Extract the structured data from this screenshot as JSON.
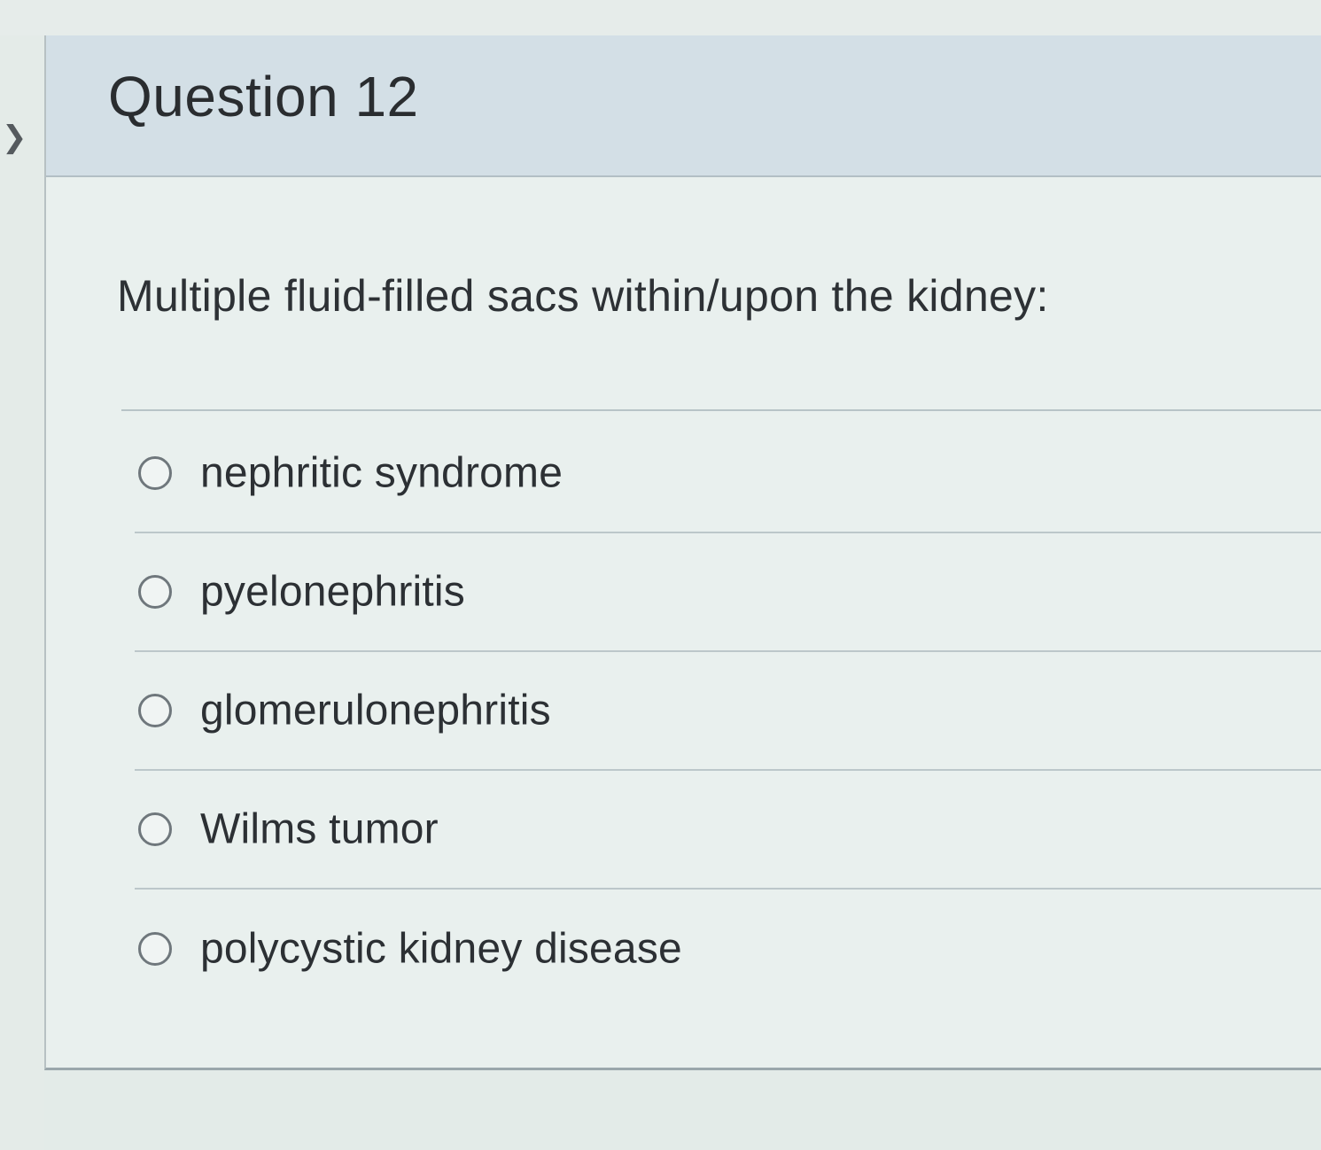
{
  "sidebar": {
    "collapse_icon": "chevron-right-icon"
  },
  "question": {
    "title": "Question 12",
    "prompt": "Multiple fluid-filled sacs within/upon the kidney:",
    "options": [
      {
        "label": "nephritic syndrome",
        "selected": false
      },
      {
        "label": "pyelonephritis",
        "selected": false
      },
      {
        "label": "glomerulonephritis",
        "selected": false
      },
      {
        "label": "Wilms tumor",
        "selected": false
      },
      {
        "label": "polycystic kidney disease",
        "selected": false
      }
    ]
  },
  "colors": {
    "header_background": "#d3dfe6",
    "card_background": "#e9f0ee",
    "text": "#2b2f33",
    "radio_border": "#6f777c"
  }
}
